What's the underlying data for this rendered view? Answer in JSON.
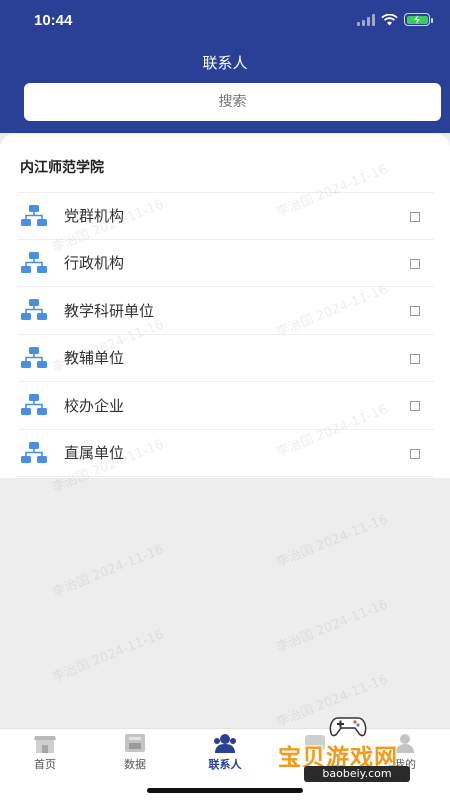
{
  "status_bar": {
    "time": "10:44"
  },
  "header": {
    "title": "联系人"
  },
  "search": {
    "placeholder": "搜索"
  },
  "organization": {
    "name": "内江师范学院"
  },
  "units": [
    {
      "label": "党群机构",
      "checked": false
    },
    {
      "label": "行政机构",
      "checked": false
    },
    {
      "label": "教学科研单位",
      "checked": false
    },
    {
      "label": "教辅单位",
      "checked": false
    },
    {
      "label": "校办企业",
      "checked": false
    },
    {
      "label": "直属单位",
      "checked": false
    }
  ],
  "watermark": {
    "text": "李治国 2024-11-16"
  },
  "tabbar": {
    "tabs": [
      {
        "label": "首页",
        "icon": "home-icon"
      },
      {
        "label": "数据",
        "icon": "data-icon"
      },
      {
        "label": "联系人",
        "icon": "contacts-icon",
        "active": true
      },
      {
        "label": "",
        "icon": "messages-icon"
      },
      {
        "label": "我的",
        "icon": "profile-icon"
      }
    ]
  },
  "logo": {
    "text": "宝贝游戏网",
    "url": "baobeiy.com"
  },
  "colors": {
    "primary": "#2a3f96",
    "icon_blue": "#4a90e2",
    "logo_orange": "#f39a18"
  }
}
